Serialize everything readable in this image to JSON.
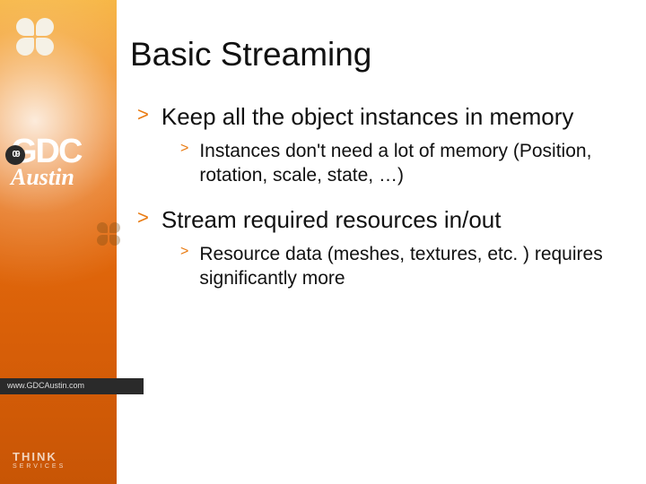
{
  "sidebar": {
    "logo_gdc": "GDC",
    "logo_year_badge": "09",
    "logo_austin": "Austin",
    "url": "www.GDCAustin.com",
    "sponsor_line1": "THINK",
    "sponsor_line2": "SERVICES"
  },
  "slide": {
    "title": "Basic Streaming",
    "bullets": [
      {
        "text": "Keep all the object instances in memory",
        "children": [
          {
            "text": "Instances don't need a lot of memory (Position, rotation, scale, state, …)"
          }
        ]
      },
      {
        "text": "Stream required resources in/out",
        "children": [
          {
            "text": "Resource data (meshes, textures, etc. ) requires significantly more"
          }
        ]
      }
    ]
  }
}
